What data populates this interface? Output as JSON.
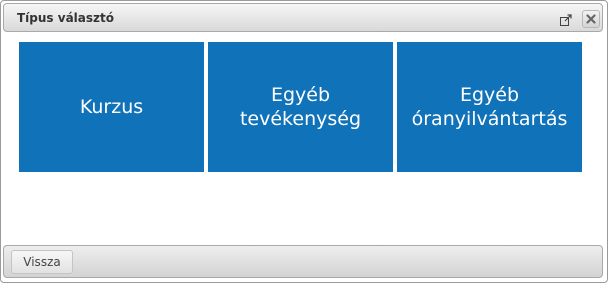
{
  "dialog": {
    "title": "Típus választó",
    "popout_icon": "external-window-icon",
    "close_icon": "close-x-icon"
  },
  "tiles": [
    {
      "label": "Kurzus"
    },
    {
      "label": "Egyéb\ntevékenység"
    },
    {
      "label": "Egyéb\nóranyilvántartás"
    }
  ],
  "footer": {
    "back_label": "Vissza"
  },
  "colors": {
    "tile_background": "#1072b8",
    "tile_text": "#ffffff"
  }
}
